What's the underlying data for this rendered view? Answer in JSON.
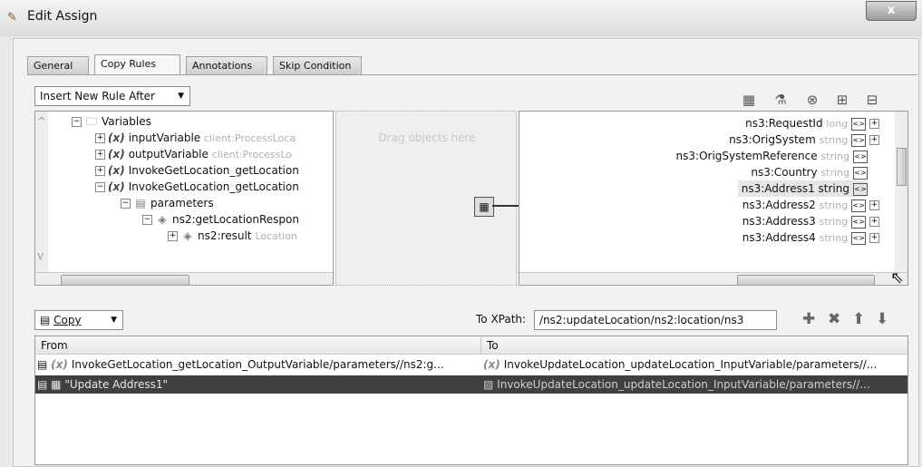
{
  "window": {
    "title": "Edit Assign",
    "close_glyph": "x"
  },
  "tabs": [
    "General",
    "Copy Rules",
    "Annotations",
    "Skip Condition"
  ],
  "insert_rule": {
    "label": "Insert New Rule After"
  },
  "toolbar_icons": [
    "function-icon",
    "transform-icon",
    "delete-icon",
    "expand-icon",
    "collapse-icon"
  ],
  "source_tree": [
    {
      "text": "Variables",
      "muted": ""
    },
    {
      "text": "inputVariable",
      "muted": "client:ProcessLoca"
    },
    {
      "text": "outputVariable",
      "muted": "client:ProcessLo"
    },
    {
      "text": "InvokeGetLocation_getLocation",
      "muted": ""
    },
    {
      "text": "InvokeGetLocation_getLocation",
      "muted": ""
    },
    {
      "text": "parameters",
      "muted": ""
    },
    {
      "text": "ns2:getLocationRespon",
      "muted": ""
    },
    {
      "text": "ns2:result",
      "muted": "Location"
    }
  ],
  "middle": {
    "drop_text": "Drag objects here"
  },
  "target_tree": [
    {
      "text": "ns3:RequestId",
      "type": "long"
    },
    {
      "text": "ns3:OrigSystem",
      "type": "string"
    },
    {
      "text": "ns3:OrigSystemReference",
      "type": "string"
    },
    {
      "text": "ns3:Country",
      "type": "string"
    },
    {
      "text": "ns3:Address1 string",
      "type": ""
    },
    {
      "text": "ns3:Address2",
      "type": "string"
    },
    {
      "text": "ns3:Address3",
      "type": "string"
    },
    {
      "text": "ns3:Address4",
      "type": "string"
    }
  ],
  "copy": {
    "label": "Copy",
    "xpath_label": "To XPath:",
    "xpath_value": "/ns2:updateLocation/ns2:location/ns3"
  },
  "rules_table": {
    "headers": [
      "From",
      "To"
    ],
    "rows": [
      {
        "from": "InvokeGetLocation_getLocation_OutputVariable/parameters//ns2:g...",
        "to": "InvokeUpdateLocation_updateLocation_InputVariable/parameters//..."
      },
      {
        "from": "\"Update Address1\"",
        "to": "InvokeUpdateLocation_updateLocation_InputVariable/parameters//..."
      }
    ]
  }
}
